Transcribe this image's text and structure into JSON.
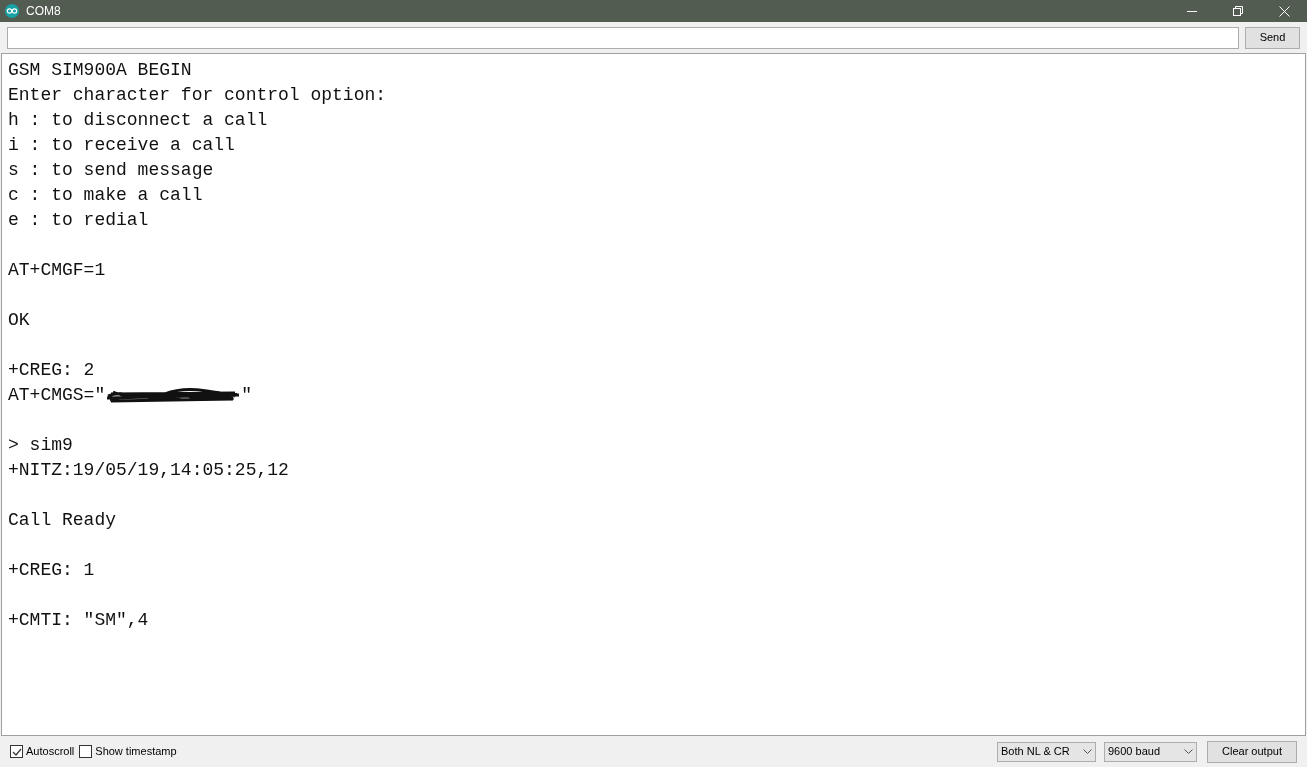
{
  "window": {
    "title": "COM8"
  },
  "send_button": "Send",
  "output": [
    {
      "kind": "text",
      "text": "GSM SIM900A BEGIN"
    },
    {
      "kind": "text",
      "text": "Enter character for control option:"
    },
    {
      "kind": "text",
      "text": "h : to disconnect a call"
    },
    {
      "kind": "text",
      "text": "i : to receive a call"
    },
    {
      "kind": "text",
      "text": "s : to send message"
    },
    {
      "kind": "text",
      "text": "c : to make a call"
    },
    {
      "kind": "text",
      "text": "e : to redial"
    },
    {
      "kind": "blank"
    },
    {
      "kind": "text",
      "text": "AT+CMGF=1"
    },
    {
      "kind": "blank"
    },
    {
      "kind": "text",
      "text": "OK"
    },
    {
      "kind": "blank"
    },
    {
      "kind": "text",
      "text": "+CREG: 2"
    },
    {
      "kind": "redacted",
      "before": "AT+CMGS=\"",
      "after": "\""
    },
    {
      "kind": "blank"
    },
    {
      "kind": "text",
      "text": "> sim9"
    },
    {
      "kind": "text",
      "text": "+NITZ:19/05/19,14:05:25,12"
    },
    {
      "kind": "blank"
    },
    {
      "kind": "text",
      "text": "Call Ready"
    },
    {
      "kind": "blank"
    },
    {
      "kind": "text",
      "text": "+CREG: 1"
    },
    {
      "kind": "blank"
    },
    {
      "kind": "text",
      "text": "+CMTI: \"SM\",4"
    }
  ],
  "footer": {
    "checkboxes": [
      {
        "label": "Autoscroll",
        "checked": true
      },
      {
        "label": "Show timestamp",
        "checked": false
      }
    ],
    "line_ending": "Both NL & CR",
    "baud": "9600 baud",
    "clear_button": "Clear output"
  }
}
